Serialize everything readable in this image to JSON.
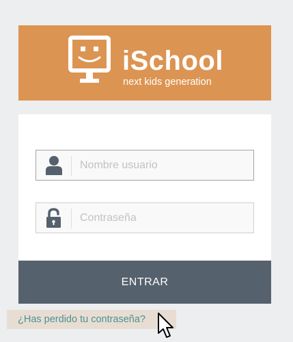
{
  "brand": {
    "name": "iSchool",
    "tagline": "next kids generation",
    "icon": "monitor-smiley-icon",
    "color": "#dc9452"
  },
  "login": {
    "username_placeholder": "Nombre usuario",
    "username_value": "",
    "username_icon": "user-icon",
    "password_placeholder": "Contraseña",
    "password_value": "",
    "password_icon": "unlock-icon",
    "submit_label": "ENTRAR",
    "submit_color": "#55616c",
    "forgot_password_label": "¿Has perdido tu contraseña?",
    "link_color": "#4b9193"
  },
  "page": {
    "background": "#edeef0"
  }
}
